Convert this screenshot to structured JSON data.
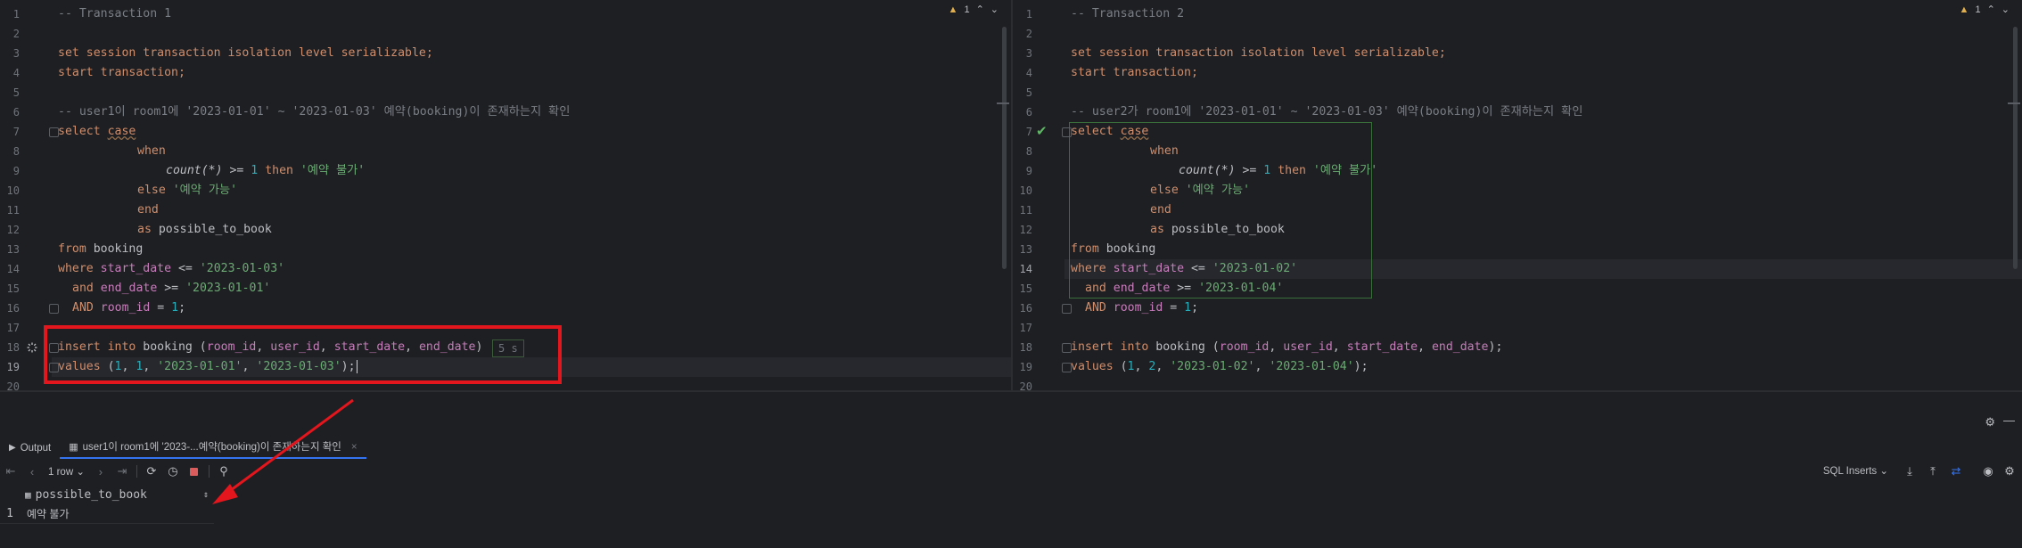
{
  "left_editor": {
    "title_comment": "-- Transaction 1",
    "warnings": "1",
    "lines": [
      {
        "n": "1"
      },
      {
        "n": "2"
      },
      {
        "n": "3"
      },
      {
        "n": "4"
      },
      {
        "n": "5"
      },
      {
        "n": "6"
      },
      {
        "n": "7"
      },
      {
        "n": "8"
      },
      {
        "n": "9"
      },
      {
        "n": "10"
      },
      {
        "n": "11"
      },
      {
        "n": "12"
      },
      {
        "n": "13"
      },
      {
        "n": "14"
      },
      {
        "n": "15"
      },
      {
        "n": "16"
      },
      {
        "n": "17"
      },
      {
        "n": "18"
      },
      {
        "n": "19"
      },
      {
        "n": "20"
      }
    ],
    "code": {
      "l3": "set session transaction isolation level serializable;",
      "l4": "start transaction;",
      "l6": "-- user1이 room1에 '2023-01-01' ~ '2023-01-03' 예약(booking)이 존재하는지 확인",
      "l7_select": "select",
      "l7_case": "case",
      "l8": "when",
      "l9_count": "count(*)",
      "l9_rest": " >= ",
      "l9_one": "1",
      "l9_then": " then ",
      "l9_str": "'예약 불가'",
      "l10_else": "else ",
      "l10_str": "'예약 가능'",
      "l11": "end",
      "l12_as": "as ",
      "l12_alias": "possible_to_book",
      "l13_from": "from ",
      "l13_tbl": "booking",
      "l14_where": "where ",
      "l14_col": "start_date",
      "l14_op": " <= ",
      "l14_str": "'2023-01-03'",
      "l15_and": "and ",
      "l15_col": "end_date",
      "l15_op": " >= ",
      "l15_str": "'2023-01-01'",
      "l16_and": "AND ",
      "l16_col": "room_id",
      "l16_op": " = ",
      "l16_num": "1",
      "l16_end": ";",
      "l18_ins": "insert into ",
      "l18_tbl": "booking",
      "l18_open": " (",
      "l18_c1": "room_id",
      "l18_c2": "user_id",
      "l18_c3": "start_date",
      "l18_c4": "end_date",
      "l18_close": ")",
      "l18_time": "5 s",
      "l19_values": "values ",
      "l19_args_a": "(",
      "l19_n1": "1",
      "l19_n2": "1",
      "l19_s1": "'2023-01-01'",
      "l19_s2": "'2023-01-03'",
      "l19_end": ");",
      "comma": ", "
    }
  },
  "right_editor": {
    "title_comment": "-- Transaction 2",
    "warnings": "1",
    "code": {
      "l3": "set session transaction isolation level serializable;",
      "l4": "start transaction;",
      "l6": "-- user2가 room1에 '2023-01-01' ~ '2023-01-03' 예약(booking)이 존재하는지 확인",
      "l7_select": "select",
      "l7_case": "case",
      "l8": "when",
      "l9_count": "count(*)",
      "l9_rest": " >= ",
      "l9_one": "1",
      "l9_then": " then ",
      "l9_str": "'예약 불가'",
      "l10_else": "else ",
      "l10_str": "'예약 가능'",
      "l11": "end",
      "l12_as": "as ",
      "l12_alias": "possible_to_book",
      "l13_from": "from ",
      "l13_tbl": "booking",
      "l14_where": "where ",
      "l14_col": "start_date",
      "l14_op": " <= ",
      "l14_str": "'2023-01-02'",
      "l15_and": "and ",
      "l15_col": "end_date",
      "l15_op": " >= ",
      "l15_str": "'2023-01-04'",
      "l16_and": "AND ",
      "l16_col": "room_id",
      "l16_op": " = ",
      "l16_num": "1",
      "l16_end": ";",
      "l18_ins": "insert into ",
      "l18_tbl": "booking",
      "l18_open": " (",
      "l18_c1": "room_id",
      "l18_c2": "user_id",
      "l18_c3": "start_date",
      "l18_c4": "end_date",
      "l18_close": ");",
      "l19_values": "values ",
      "l19_args_a": "(",
      "l19_n1": "1",
      "l19_n2": "2",
      "l19_s1": "'2023-01-02'",
      "l19_s2": "'2023-01-04'",
      "l19_end": ");",
      "comma": ", "
    }
  },
  "bottom_panel": {
    "tab_output": "Output",
    "tab_result": "user1이 room1에 '2023-...예약(booking)이 존재하는지 확인",
    "rows_label": "1 row",
    "sql_inserts": "SQL Inserts",
    "column_header": "possible_to_book",
    "row_number": "1",
    "row_value": "예약 불가"
  }
}
